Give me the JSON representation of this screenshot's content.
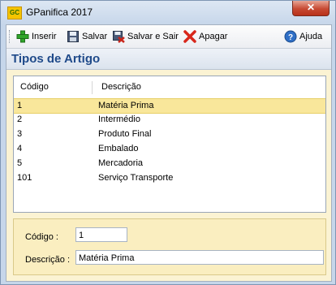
{
  "window": {
    "title": "GPanifica 2017",
    "app_icon_text": "GC",
    "close_label": "✕"
  },
  "toolbar": {
    "insert_label": "Inserir",
    "save_label": "Salvar",
    "save_exit_label": "Salvar e Sair",
    "delete_label": "Apagar",
    "help_label": "Ajuda"
  },
  "page": {
    "heading": "Tipos de Artigo"
  },
  "table": {
    "columns": [
      "Código",
      "Descrição"
    ],
    "rows": [
      {
        "code": "1",
        "desc": "Matéria Prima"
      },
      {
        "code": "2",
        "desc": "Intermédio"
      },
      {
        "code": "3",
        "desc": "Produto Final"
      },
      {
        "code": "4",
        "desc": "Embalado"
      },
      {
        "code": "5",
        "desc": "Mercadoria"
      },
      {
        "code": "101",
        "desc": "Serviço Transporte"
      }
    ],
    "selected_index": 0
  },
  "form": {
    "code_label": "Código :",
    "code_value": "1",
    "desc_label": "Descrição :",
    "desc_value": "Matéria Prima"
  },
  "colors": {
    "heading": "#1f4a8a",
    "selection": "#f9e79b",
    "panel": "#fbf3d3"
  },
  "icons": [
    "app-icon",
    "add-icon",
    "save-icon",
    "save-exit-icon",
    "delete-icon",
    "help-icon",
    "close-icon"
  ]
}
